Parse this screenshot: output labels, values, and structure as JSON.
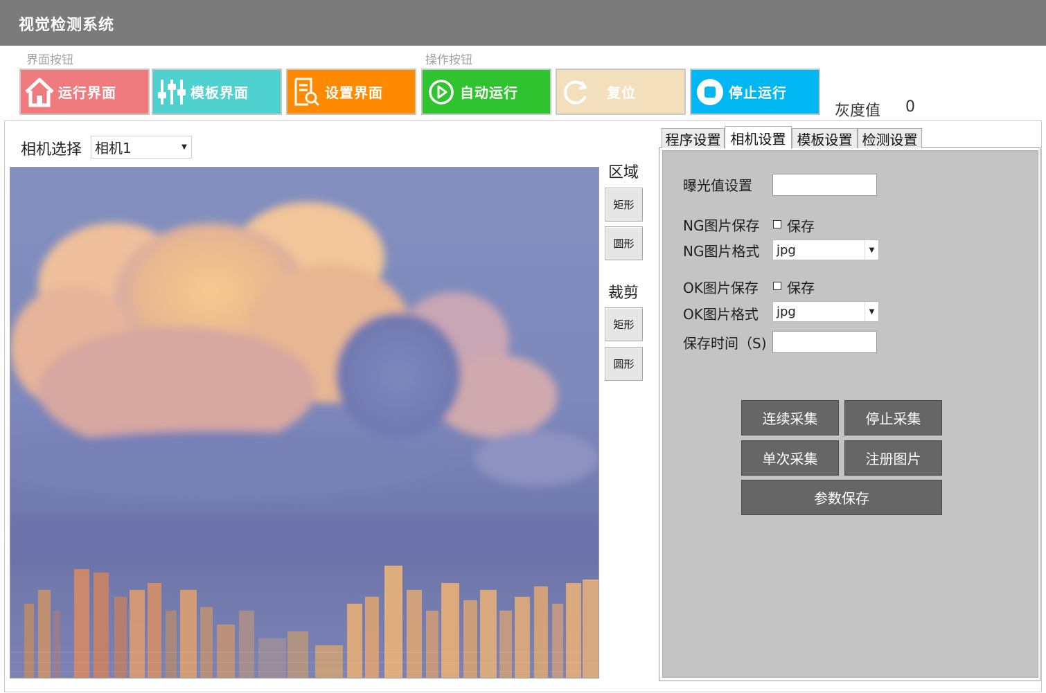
{
  "app": {
    "title": "视觉检测系统"
  },
  "groups": {
    "interface_label": "界面按钮",
    "operation_label": "操作按钮"
  },
  "toolbar": {
    "run_ui": "运行界面",
    "template_ui": "模板界面",
    "settings_ui": "设置界面",
    "auto_run": "自动运行",
    "reset": "复位",
    "stop_run": "停止运行"
  },
  "colors": {
    "titlebar": "#7b7b7b",
    "run_ui": "#ef7b7e",
    "template_ui": "#4fd1d0",
    "settings_ui": "#ff8a00",
    "auto_run": "#2fc32f",
    "reset": "#f4dfbd",
    "stop_run": "#00b7f4",
    "panel": "#c4c4c4",
    "dark_button": "#666666"
  },
  "gray": {
    "label": "灰度值",
    "value": "0"
  },
  "camera": {
    "label": "相机选择",
    "selected": "相机1"
  },
  "side": {
    "region_label": "区域",
    "region_rect": "矩形",
    "region_circle": "圆形",
    "crop_label": "裁剪",
    "crop_rect": "矩形",
    "crop_circle": "圆形"
  },
  "tabs": [
    {
      "label": "程序设置",
      "active": false
    },
    {
      "label": "相机设置",
      "active": true
    },
    {
      "label": "模板设置",
      "active": false
    },
    {
      "label": "检测设置",
      "active": false
    }
  ],
  "camera_settings": {
    "exposure_label": "曝光值设置",
    "exposure_value": "",
    "ng_save_label": "NG图片保存",
    "ng_save_checkbox": "保存",
    "ng_format_label": "NG图片格式",
    "ng_format_value": "jpg",
    "ok_save_label": "OK图片保存",
    "ok_save_checkbox": "保存",
    "ok_format_label": "OK图片格式",
    "ok_format_value": "jpg",
    "save_time_label": "保存时间（S)",
    "save_time_value": ""
  },
  "actions": {
    "continuous": "连续采集",
    "stop_capture": "停止采集",
    "single": "单次采集",
    "register": "注册图片",
    "save_params": "参数保存"
  }
}
